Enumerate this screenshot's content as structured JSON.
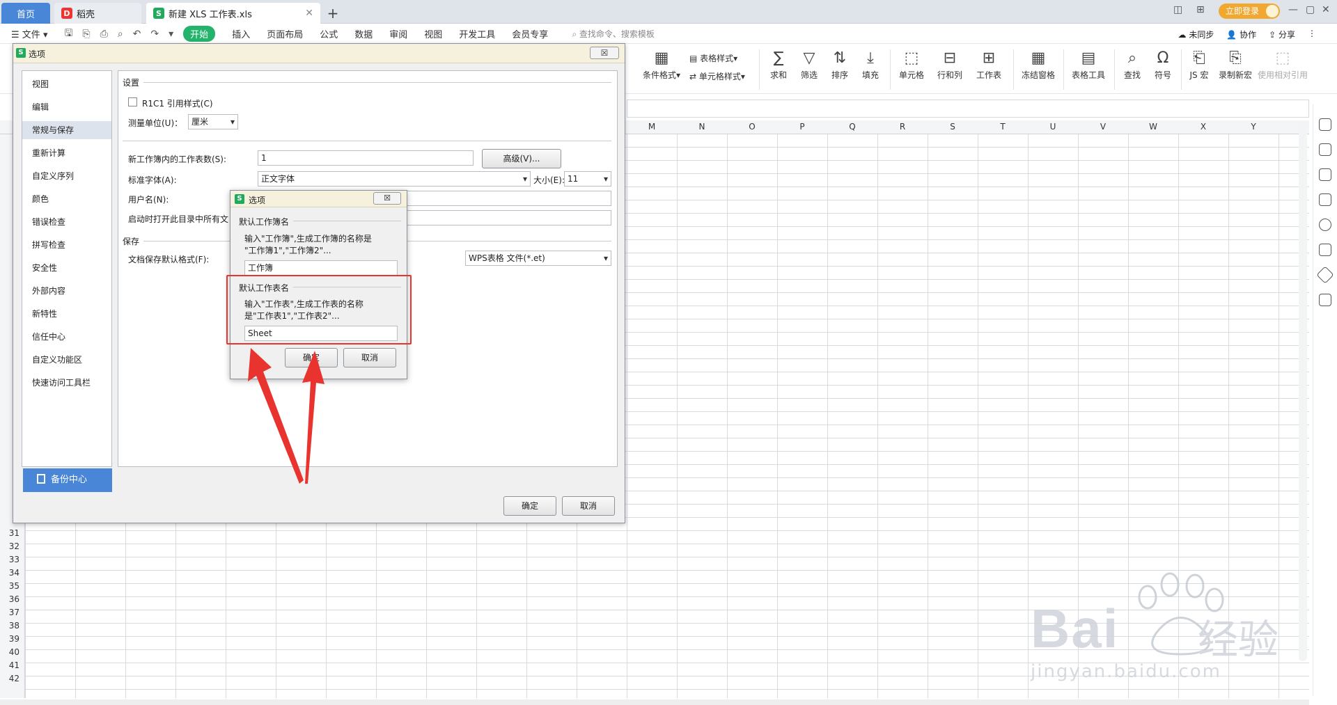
{
  "titlebar": {
    "home_tab": "首页",
    "daoke_tab": "稻壳",
    "doc_tab": "新建 XLS 工作表.xls",
    "add_tab": "+",
    "login": "立即登录",
    "win_controls": [
      "—",
      "▢",
      "✕"
    ]
  },
  "menubar": {
    "file": "文件",
    "items": [
      "开始",
      "插入",
      "页面布局",
      "公式",
      "数据",
      "审阅",
      "视图",
      "开发工具",
      "会员专享"
    ],
    "search": "查找命令、搜索模板",
    "right": [
      "未同步",
      "协作",
      "分享"
    ]
  },
  "ribbon": {
    "table_style": "表格样式",
    "cond_format": "条件格式",
    "cell_style": "单元格样式",
    "buttons": [
      "求和",
      "筛选",
      "排序",
      "填充",
      "单元格",
      "行和列",
      "工作表",
      "冻结窗格",
      "表格工具",
      "查找",
      "符号",
      "JS 宏",
      "录制新宏",
      "使用相对引用"
    ]
  },
  "sheet": {
    "columns": [
      "M",
      "N",
      "O",
      "P",
      "Q",
      "R",
      "S",
      "T",
      "U",
      "V",
      "W",
      "X",
      "Y"
    ],
    "rows": [
      "31",
      "32",
      "33",
      "34",
      "35",
      "36",
      "37",
      "38",
      "39",
      "40",
      "41",
      "42"
    ]
  },
  "options_dialog": {
    "title": "选项",
    "close": "☒",
    "nav": [
      "视图",
      "编辑",
      "常规与保存",
      "重新计算",
      "自定义序列",
      "颜色",
      "错误检查",
      "拼写检查",
      "安全性",
      "外部内容",
      "新特性",
      "信任中心",
      "自定义功能区",
      "快速访问工具栏"
    ],
    "nav_selected": "常规与保存",
    "backup": "备份中心",
    "settings_header": "设置",
    "r1c1": "R1C1 引用样式(C)",
    "unit_label": "测量单位(U)：",
    "unit_value": "厘米",
    "sheets_count_label": "新工作簿内的工作表数(S):",
    "sheets_count_value": "1",
    "advanced_button": "高级(V)...",
    "font_label": "标准字体(A):",
    "font_value": "正文字体",
    "size_label": "大小(E):",
    "size_value": "11",
    "username_label": "用户名(N):",
    "startup_label": "启动时打开此目录中所有文",
    "save_header": "保存",
    "save_format_label": "文档保存默认格式(F):",
    "save_format_value": "WPS表格 文件(*.et)",
    "ok": "确定",
    "cancel": "取消"
  },
  "name_dialog": {
    "title": "选项",
    "close": "☒",
    "workbook_section": "默认工作簿名",
    "workbook_desc1": "输入\"工作簿\",生成工作簿的名称是",
    "workbook_desc2": "\"工作簿1\",\"工作簿2\"...",
    "workbook_value": "工作簿",
    "sheet_section": "默认工作表名",
    "sheet_desc1": "输入\"工作表\",生成工作表的名称",
    "sheet_desc2": "是\"工作表1\",\"工作表2\"...",
    "sheet_value": "Sheet",
    "ok": "确定",
    "cancel": "取消"
  },
  "watermark": {
    "logo": "Bai",
    "logo_cn": "经验",
    "url": "jingyan.baidu.com"
  },
  "colors": {
    "accent_green": "#24b36b",
    "home_blue": "#4a86d8",
    "annotation_red": "#e8332f"
  }
}
